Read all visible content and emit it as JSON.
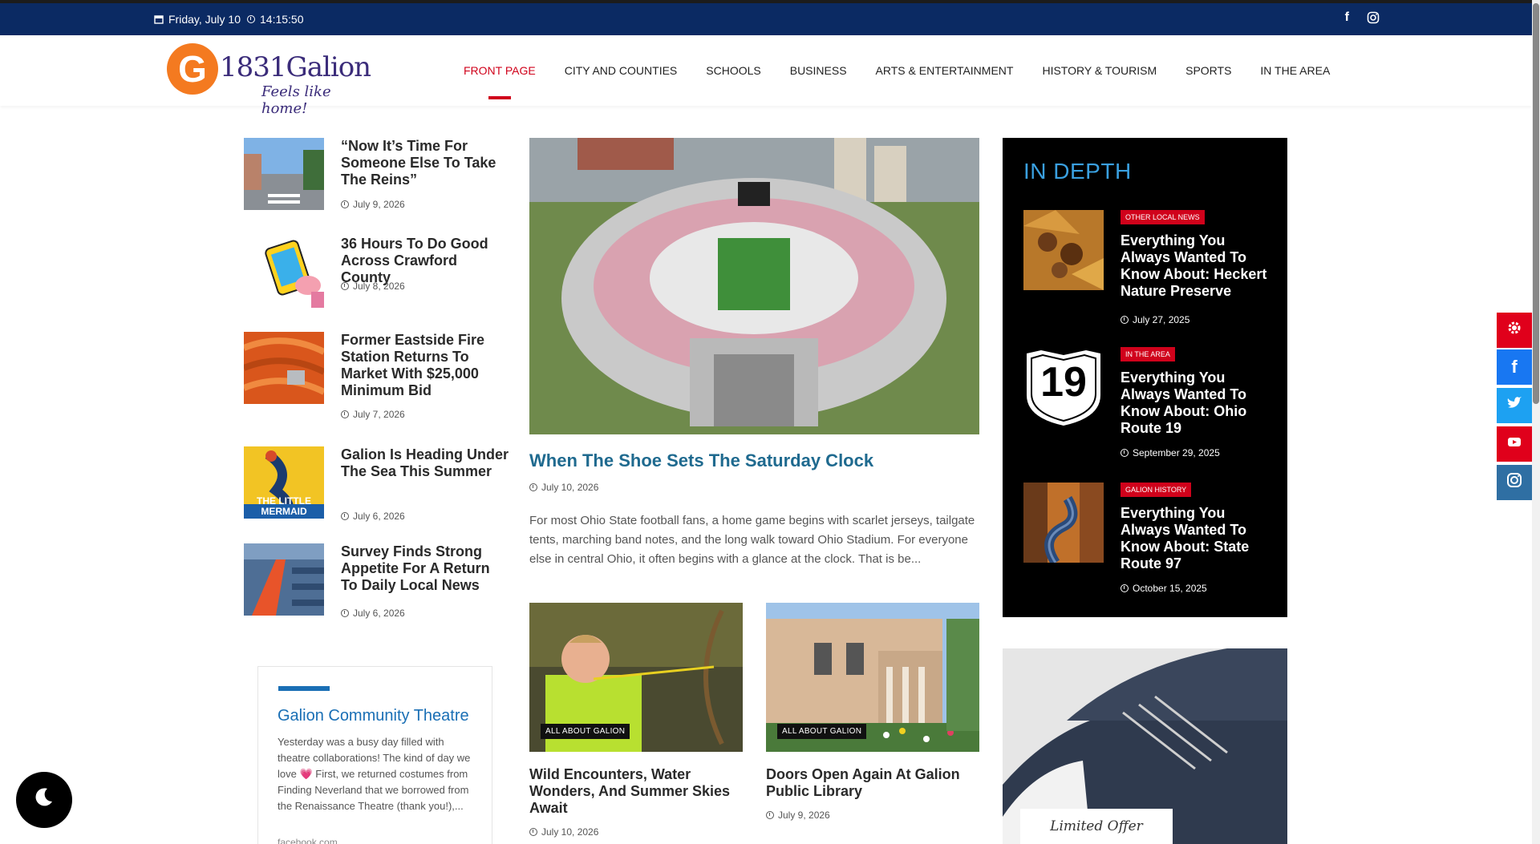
{
  "topbar": {
    "date": "Friday, July 10",
    "time": "14:15:50",
    "social_icons": [
      "facebook-icon",
      "instagram-icon"
    ]
  },
  "brand": {
    "logo_letter": "G",
    "name": "1831Galion",
    "tagline": "Feels like home!",
    "accent_orange": "#f47a20",
    "logo_color": "#3b2c7a"
  },
  "nav": {
    "items": [
      "FRONT PAGE",
      "CITY AND COUNTIES",
      "SCHOOLS",
      "BUSINESS",
      "ARTS & ENTERTAINMENT",
      "HISTORY & TOURISM",
      "SPORTS",
      "IN THE AREA"
    ],
    "active": "FRONT PAGE",
    "active_color": "#d0021b"
  },
  "left_posts": [
    {
      "title": "“Now It’s Time For Someone Else To Take The Reins”",
      "date": "July 9, 2026"
    },
    {
      "title": "36 Hours To Do Good Across Crawford County",
      "date": "July 8, 2026"
    },
    {
      "title": "Former Eastside Fire Station Returns To Market With $25,000 Minimum Bid",
      "date": "July 7, 2026"
    },
    {
      "title": "Galion Is Heading Under The Sea This Summer",
      "date": "July 6, 2026",
      "image_text": "THE LITTLE MERMAID"
    },
    {
      "title": "Survey Finds Strong Appetite For A Return To Daily Local News",
      "date": "July 6, 2026"
    }
  ],
  "facebook_card": {
    "title": "Galion Community Theatre",
    "text": "Yesterday was a busy day filled with theatre collaborations! The kind of day we love 💗 First, we returned costumes from Finding Neverland that we borrowed from the Renaissance Theatre (thank you!),...",
    "source": "facebook.com"
  },
  "hero": {
    "title": "When The Shoe Sets The Saturday Clock",
    "date": "July 10, 2026",
    "excerpt": "For most Ohio State football fans, a home game begins with scarlet jerseys, tailgate tents, marching band notes, and the long walk toward Ohio Stadium. For everyone else in central Ohio, it often begins with a glance at the clock. That is be...",
    "title_color": "#1f6a8f"
  },
  "cards": [
    {
      "badge": "ALL ABOUT GALION",
      "title": "Wild Encounters, Water Wonders, And Summer Skies Await",
      "date": "July 10, 2026"
    },
    {
      "badge": "ALL ABOUT GALION",
      "title": "Doors Open Again At Galion Public Library",
      "date": "July 9, 2026"
    }
  ],
  "in_depth": {
    "header": "IN DEPTH",
    "posts": [
      {
        "category": "OTHER LOCAL NEWS",
        "title": "Everything You Always Wanted To Know About: Heckert Nature Preserve",
        "date": "July 27, 2025"
      },
      {
        "category": "IN THE AREA",
        "title": "Everything You Always Wanted To Know About: Ohio Route 19",
        "date": "September 29, 2025",
        "image_text": "19"
      },
      {
        "category": "GALION HISTORY",
        "title": "Everything You Always Wanted To Know About: State Route 97",
        "date": "October 15, 2025"
      }
    ]
  },
  "ad": {
    "offer_label": "Limited Offer"
  },
  "side_buttons": [
    {
      "icon": "gear-icon",
      "color": "#e0001b"
    },
    {
      "icon": "facebook-icon",
      "color": "#1877f2"
    },
    {
      "icon": "twitter-icon",
      "color": "#1da1f2"
    },
    {
      "icon": "youtube-icon",
      "color": "#e0001b"
    },
    {
      "icon": "instagram-icon",
      "color": "#2f6fa3"
    }
  ],
  "dark_mode_icon": "moon-icon"
}
